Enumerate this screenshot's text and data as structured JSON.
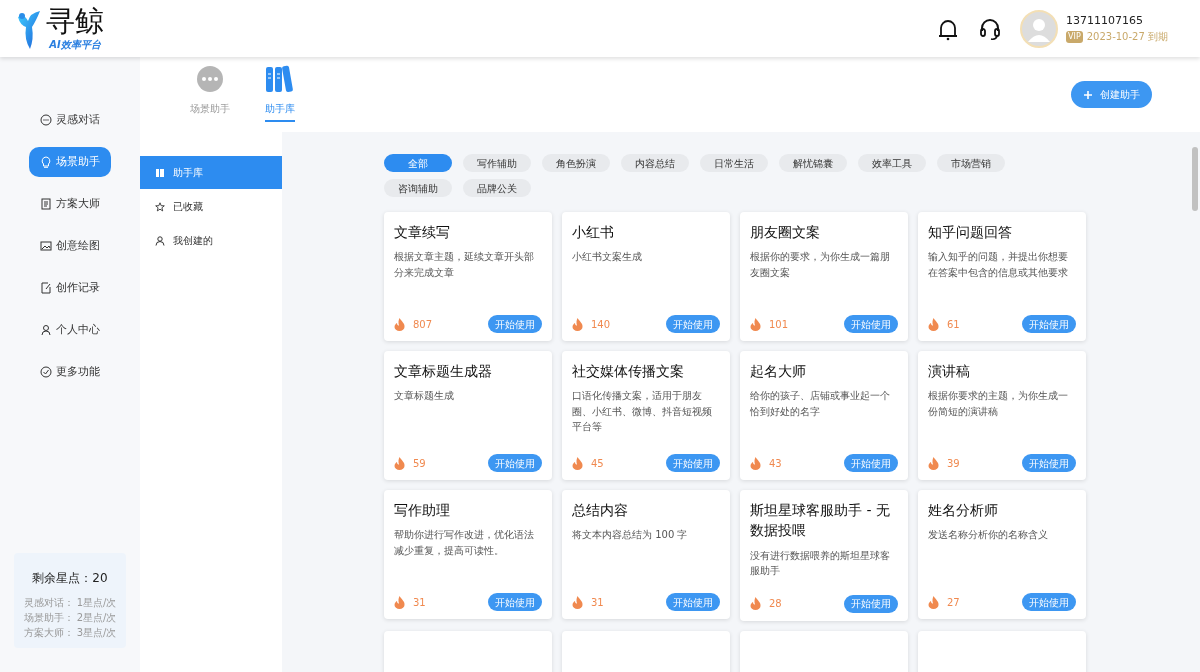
{
  "header": {
    "logo": {
      "name": "寻鲸",
      "tagline": "AI效率平台"
    },
    "user": {
      "phone": "13711107165",
      "vip_badge": "VIP",
      "expiry": "2023-10-27 到期"
    }
  },
  "sidebar": {
    "items": [
      {
        "label": "灵感对话",
        "selected": false
      },
      {
        "label": "场景助手",
        "selected": true
      },
      {
        "label": "方案大师",
        "selected": false
      },
      {
        "label": "创意绘图",
        "selected": false
      },
      {
        "label": "创作记录",
        "selected": false
      },
      {
        "label": "个人中心",
        "selected": false
      },
      {
        "label": "更多功能",
        "selected": false
      }
    ],
    "points": {
      "title": "剩余星点：20",
      "rates": [
        {
          "label": "灵感对话：",
          "value": "1星点/次"
        },
        {
          "label": "场景助手：",
          "value": "2星点/次"
        },
        {
          "label": "方案大师：",
          "value": "3星点/次"
        }
      ]
    }
  },
  "top_tabs": [
    {
      "label": "场景助手",
      "selected": false
    },
    {
      "label": "助手库",
      "selected": true
    }
  ],
  "create_button": "创建助手",
  "sub_nav": [
    {
      "label": "助手库",
      "selected": true
    },
    {
      "label": "已收藏",
      "selected": false
    },
    {
      "label": "我创建的",
      "selected": false
    }
  ],
  "categories": [
    {
      "label": "全部",
      "selected": true
    },
    {
      "label": "写作辅助",
      "selected": false
    },
    {
      "label": "角色扮演",
      "selected": false
    },
    {
      "label": "内容总结",
      "selected": false
    },
    {
      "label": "日常生活",
      "selected": false
    },
    {
      "label": "解忧锦囊",
      "selected": false
    },
    {
      "label": "效率工具",
      "selected": false
    },
    {
      "label": "市场营销",
      "selected": false
    },
    {
      "label": "咨询辅助",
      "selected": false
    },
    {
      "label": "品牌公关",
      "selected": false
    }
  ],
  "cards": [
    {
      "kind": "full",
      "title": "文章续写",
      "description": "根据文章主题，延续文章开头部分来完成文章",
      "count": "807",
      "button": "开始使用"
    },
    {
      "kind": "full",
      "title": "小红书",
      "description": "小红书文案生成",
      "count": "140",
      "button": "开始使用"
    },
    {
      "kind": "full",
      "title": "朋友圈文案",
      "description": "根据你的要求，为你生成一篇朋友圈文案",
      "count": "101",
      "button": "开始使用"
    },
    {
      "kind": "full",
      "title": "知乎问题回答",
      "description": "输入知乎的问题，并提出你想要在答案中包含的信息或其他要求",
      "count": "61",
      "button": "开始使用"
    },
    {
      "kind": "full",
      "title": "文章标题生成器",
      "description": "文章标题生成",
      "count": "59",
      "button": "开始使用"
    },
    {
      "kind": "full",
      "title": "社交媒体传播文案",
      "description": "口语化传播文案，适用于朋友圈、小红书、微博、抖音短视频平台等",
      "count": "45",
      "button": "开始使用"
    },
    {
      "kind": "full",
      "title": "起名大师",
      "description": "给你的孩子、店铺或事业起一个恰到好处的名字",
      "count": "43",
      "button": "开始使用"
    },
    {
      "kind": "full",
      "title": "演讲稿",
      "description": "根据你要求的主题，为你生成一份简短的演讲稿",
      "count": "39",
      "button": "开始使用"
    },
    {
      "kind": "full",
      "title": "写作助理",
      "description": "帮助你进行写作改进，优化语法减少重复，提高可读性。",
      "count": "31",
      "button": "开始使用"
    },
    {
      "kind": "full",
      "title": "总结内容",
      "description": "将文本内容总结为 100 字",
      "count": "31",
      "button": "开始使用"
    },
    {
      "kind": "full",
      "title": "斯坦星球客服助手 - 无数据投喂",
      "description": "没有进行数据喂养的斯坦星球客服助手",
      "count": "28",
      "button": "开始使用"
    },
    {
      "kind": "full",
      "title": "姓名分析师",
      "description": "发送名称分析你的名称含义",
      "count": "27",
      "button": "开始使用"
    },
    {
      "kind": "cut"
    },
    {
      "kind": "cut"
    },
    {
      "kind": "cut"
    },
    {
      "kind": "cut"
    }
  ]
}
